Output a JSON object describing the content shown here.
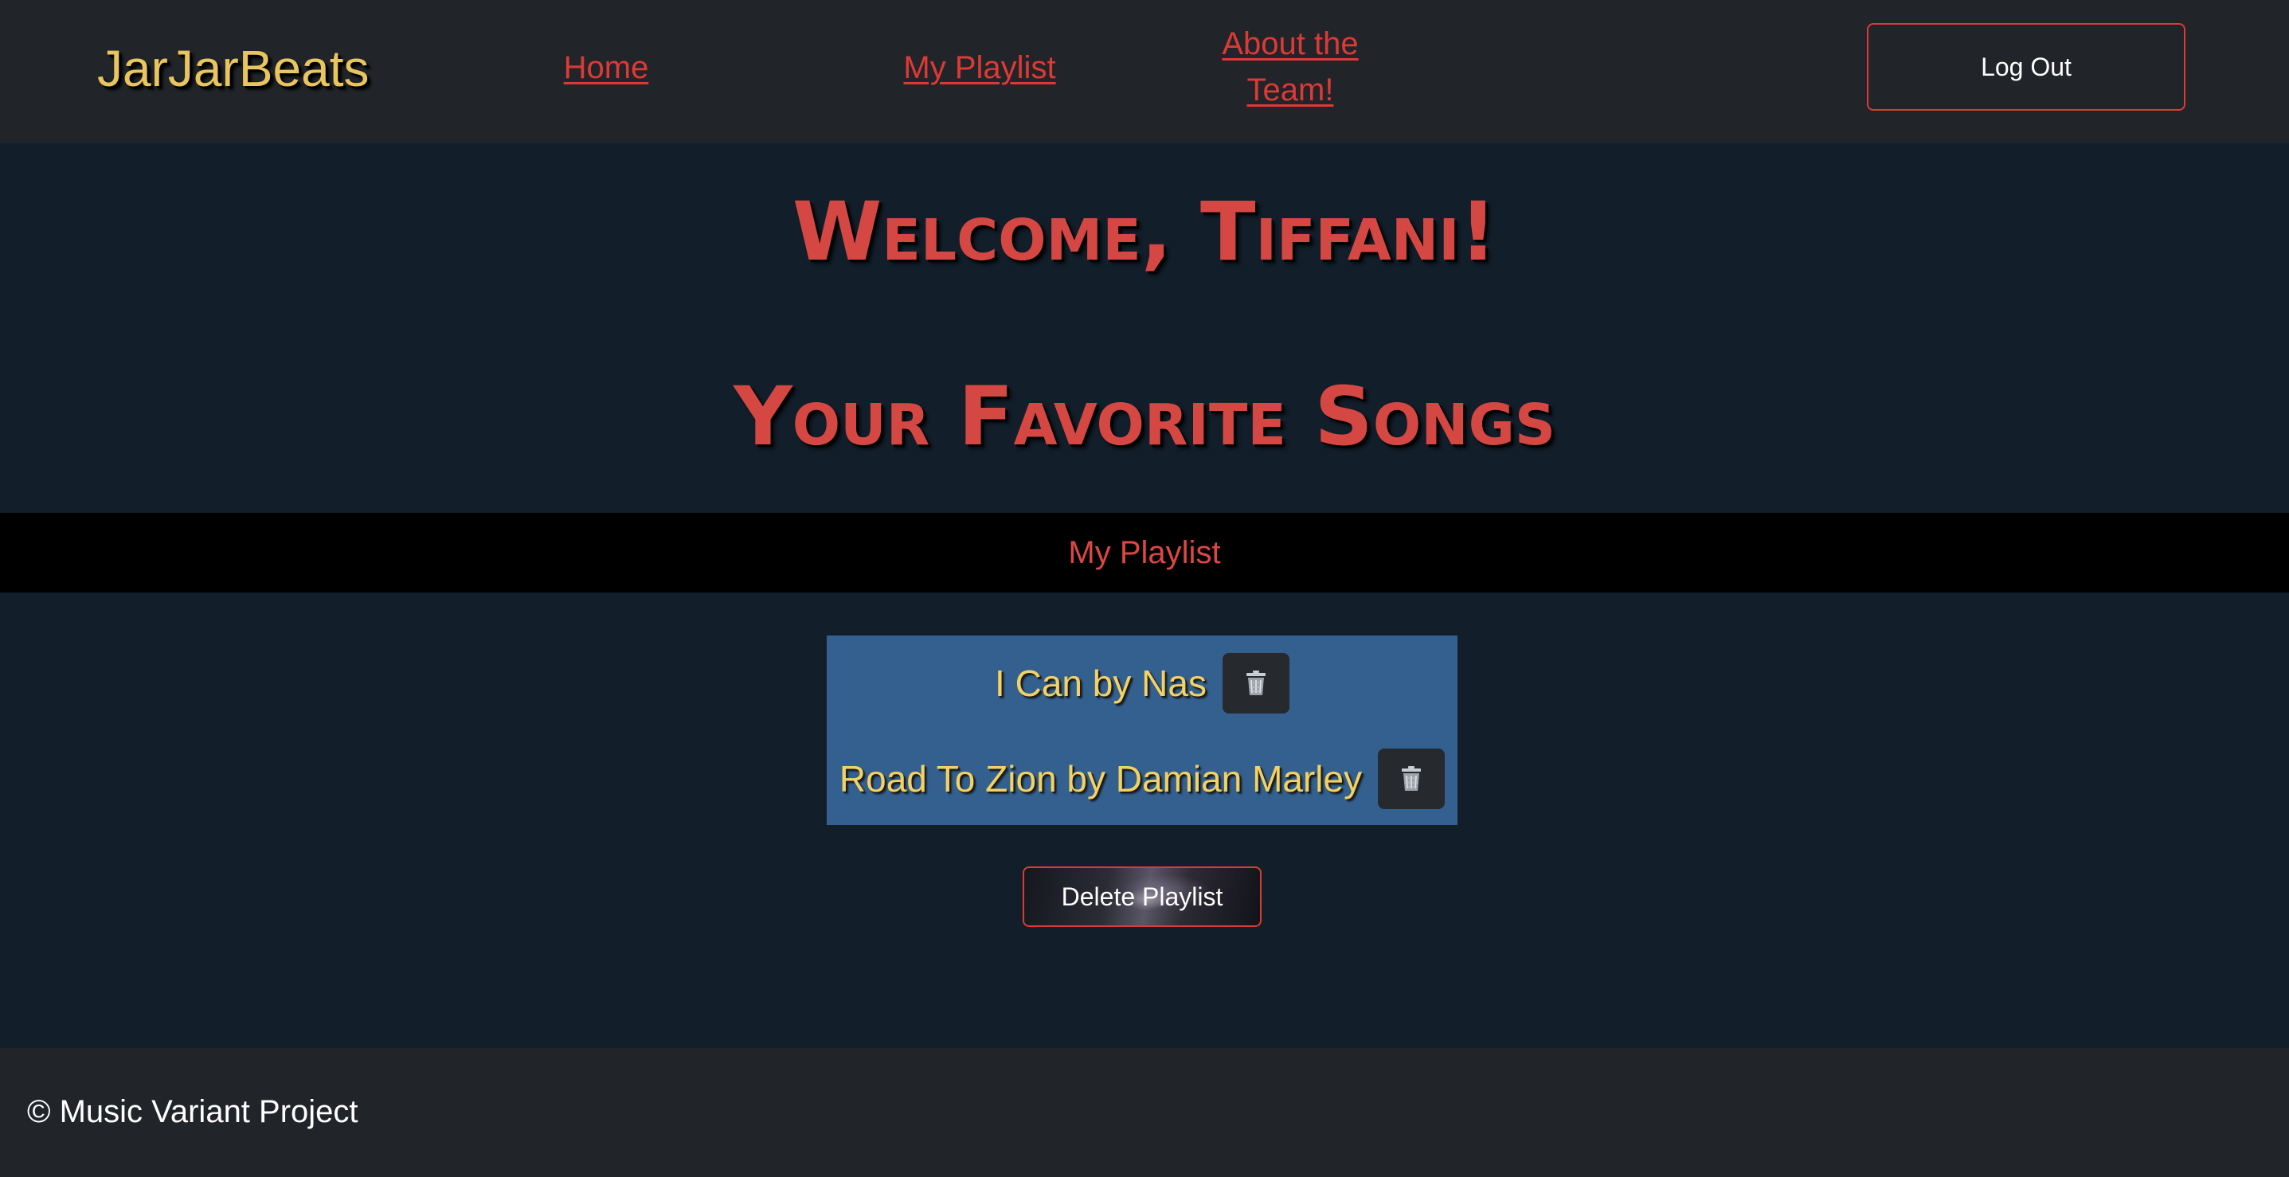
{
  "navbar": {
    "brand": "JarJarBeats",
    "links": [
      {
        "label": "Home"
      },
      {
        "label": "My Playlist"
      },
      {
        "label": "About the Team!"
      }
    ],
    "logout_label": "Log Out"
  },
  "main": {
    "welcome": "Welcome, Tiffani!",
    "favorites_heading": "Your Favorite Songs",
    "playlist_bar_label": "My Playlist",
    "songs": [
      {
        "title": "I Can by Nas",
        "delete_icon": "trash-icon"
      },
      {
        "title": "Road To Zion by Damian Marley",
        "delete_icon": "trash-icon"
      }
    ],
    "delete_playlist_label": "Delete Playlist"
  },
  "footer": {
    "text": "© Music Variant Project"
  },
  "colors": {
    "background": "#121e2a",
    "navbar_bg": "#212429",
    "accent_red": "#dc3a35",
    "brand_yellow": "#e8c55e",
    "song_yellow": "#f2d264",
    "song_list_bg": "#34608f"
  }
}
